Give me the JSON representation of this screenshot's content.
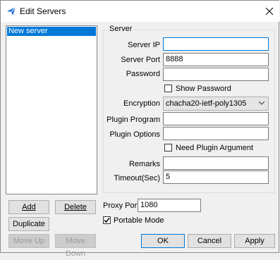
{
  "window": {
    "title": "Edit Servers"
  },
  "server_list": {
    "items": [
      "New server"
    ]
  },
  "server_group": {
    "title": "Server",
    "server_ip_label": "Server IP",
    "server_ip_value": "",
    "server_port_label": "Server Port",
    "server_port_value": "8888",
    "password_label": "Password",
    "password_value": "",
    "show_password_label": "Show Password",
    "encryption_label": "Encryption",
    "encryption_value": "chacha20-ietf-poly1305",
    "plugin_program_label": "Plugin Program",
    "plugin_program_value": "",
    "plugin_options_label": "Plugin Options",
    "plugin_options_value": "",
    "need_plugin_argument_label": "Need Plugin Argument",
    "remarks_label": "Remarks",
    "remarks_value": "",
    "timeout_label": "Timeout(Sec)",
    "timeout_value": "5"
  },
  "list_buttons": {
    "add": "Add",
    "delete": "Delete",
    "duplicate": "Duplicate",
    "move_up": "Move Up",
    "move_down": "Move Down"
  },
  "proxy": {
    "proxy_port_label": "Proxy Port",
    "proxy_port_value": "1080",
    "portable_mode_label": "Portable Mode",
    "portable_mode_checked": true
  },
  "dialog_buttons": {
    "ok": "OK",
    "cancel": "Cancel",
    "apply": "Apply"
  },
  "colors": {
    "selection": "#0078d7",
    "focus_border": "#0078d7"
  }
}
